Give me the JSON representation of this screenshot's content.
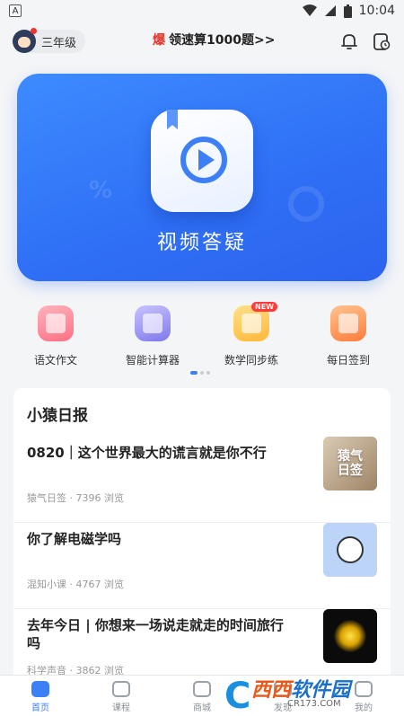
{
  "status_bar": {
    "time": "10:04",
    "left_badge": "A"
  },
  "header": {
    "grade": "三年级",
    "promo_hot": "爆",
    "promo_text": "领速算1000题>>"
  },
  "banner": {
    "title": "视频答疑"
  },
  "tools": [
    {
      "label": "语文作文",
      "icon": "essay-book-icon"
    },
    {
      "label": "智能计算器",
      "icon": "calculator-icon"
    },
    {
      "label": "数学同步练",
      "icon": "math-practice-icon",
      "badge": "NEW"
    },
    {
      "label": "每日签到",
      "icon": "calendar-checkin-icon"
    }
  ],
  "daily": {
    "title": "小猿日报",
    "articles": [
      {
        "title": "0820｜这个世界最大的谎言就是你不行",
        "meta": "猿气日签 · 7396 浏览",
        "thumb_text": "猿气\n日签"
      },
      {
        "title": "你了解电磁学吗",
        "meta": "混知小课 · 4767 浏览"
      },
      {
        "title": "去年今日 | 你想来一场说走就走的时间旅行吗",
        "meta": "科学声音 · 3862 浏览"
      }
    ]
  },
  "bottom_nav": [
    {
      "label": "首页",
      "active": true
    },
    {
      "label": "课程",
      "active": false
    },
    {
      "label": "商城",
      "active": false
    },
    {
      "label": "发现",
      "active": false
    },
    {
      "label": "我的",
      "active": false
    }
  ],
  "watermark": {
    "main_a": "西西",
    "main_b": "软件园",
    "sub": "CR173.COM"
  },
  "colors": {
    "accent": "#3d7ff7",
    "hot": "#e8342a"
  }
}
